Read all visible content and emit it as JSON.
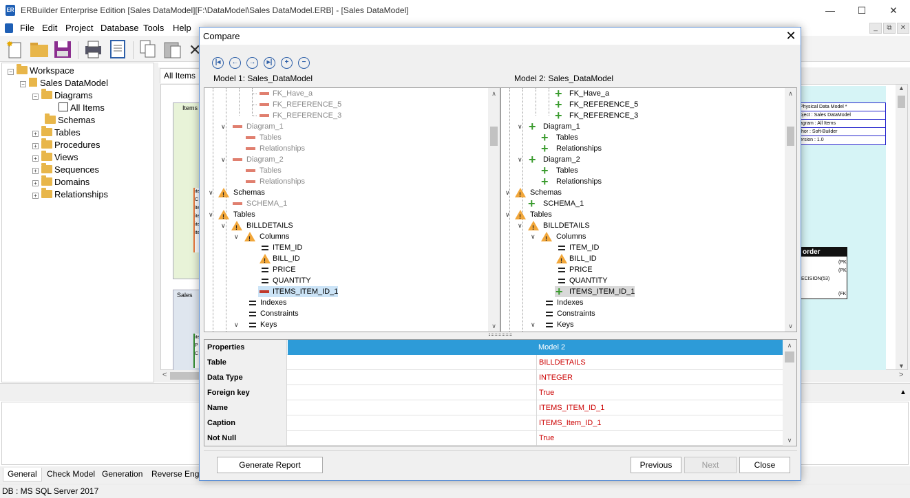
{
  "window": {
    "title": "ERBuilder Enterprise Edition [Sales DataModel][F:\\DataModel\\Sales DataModel.ERB] - [Sales DataModel]",
    "minimize": "—",
    "maximize": "☐",
    "close": "✕"
  },
  "menu": [
    "File",
    "Edit",
    "Project",
    "Database",
    "Tools",
    "Help"
  ],
  "workspace_tree": {
    "workspace": "Workspace",
    "model": "Sales DataModel",
    "diagrams": "Diagrams",
    "all_items": "All Items",
    "schemas": "Schemas",
    "tables": "Tables",
    "procedures": "Procedures",
    "views": "Views",
    "sequences": "Sequences",
    "domains": "Domains",
    "relationships": "Relationships"
  },
  "document_tab": "All Items",
  "canvas": {
    "items_label": "Items",
    "sales_label": "Sales",
    "info_box": [
      "Physical Data Model *",
      "oject : Sales DataModel",
      "agram : All Items",
      "thor : Soft-Builder",
      "ersion : 1.0"
    ],
    "order_table": {
      "header": "order",
      "lines": [
        "(PK",
        "(PK",
        "ECISION(53)",
        "(FK"
      ]
    },
    "left_fragments": [
      "ite",
      "C",
      "ite",
      "ite",
      "ite",
      "ite"
    ],
    "green_fragments": [
      "ite",
      "P",
      "C"
    ]
  },
  "bottom_tabs": [
    "General",
    "Check Model",
    "Generation",
    "Reverse Engin"
  ],
  "status": "DB : MS SQL Server 2017",
  "dialog": {
    "title": "Compare",
    "model1_label": "Model 1: Sales_DataModel",
    "model2_label": "Model 2: Sales_DataModel",
    "left_rows": [
      {
        "text": "FK_Have_a"
      },
      {
        "text": "FK_REFERENCE_5"
      },
      {
        "text": "FK_REFERENCE_3"
      },
      {
        "text": "Diagram_1"
      },
      {
        "text": "Tables"
      },
      {
        "text": "Relationships"
      },
      {
        "text": "Diagram_2"
      },
      {
        "text": "Tables"
      },
      {
        "text": "Relationships"
      },
      {
        "text": "Schemas"
      },
      {
        "text": "SCHEMA_1"
      },
      {
        "text": "Tables"
      },
      {
        "text": "BILLDETAILS"
      },
      {
        "text": "Columns"
      },
      {
        "text": "ITEM_ID"
      },
      {
        "text": "BILL_ID"
      },
      {
        "text": "PRICE"
      },
      {
        "text": "QUANTITY"
      },
      {
        "text": "ITEMS_ITEM_ID_1"
      },
      {
        "text": "Indexes"
      },
      {
        "text": "Constraints"
      },
      {
        "text": "Keys"
      }
    ],
    "right_rows": [
      {
        "text": "FK_Have_a"
      },
      {
        "text": "FK_REFERENCE_5"
      },
      {
        "text": "FK_REFERENCE_3"
      },
      {
        "text": "Diagram_1"
      },
      {
        "text": "Tables"
      },
      {
        "text": "Relationships"
      },
      {
        "text": "Diagram_2"
      },
      {
        "text": "Tables"
      },
      {
        "text": "Relationships"
      },
      {
        "text": "Schemas"
      },
      {
        "text": "SCHEMA_1"
      },
      {
        "text": "Tables"
      },
      {
        "text": "BILLDETAILS"
      },
      {
        "text": "Columns"
      },
      {
        "text": "ITEM_ID"
      },
      {
        "text": "BILL_ID"
      },
      {
        "text": "PRICE"
      },
      {
        "text": "QUANTITY"
      },
      {
        "text": "ITEMS_ITEM_ID_1"
      },
      {
        "text": "Indexes"
      },
      {
        "text": "Constraints"
      },
      {
        "text": "Keys"
      }
    ],
    "properties": {
      "header_name": "Properties",
      "header_model2": "Model 2",
      "rows": [
        {
          "name": "Table",
          "model2": "BILLDETAILS"
        },
        {
          "name": "Data Type",
          "model2": "INTEGER"
        },
        {
          "name": "Foreign key",
          "model2": "True"
        },
        {
          "name": "Name",
          "model2": "ITEMS_ITEM_ID_1"
        },
        {
          "name": "Caption",
          "model2": "ITEMS_Item_ID_1"
        },
        {
          "name": "Not Null",
          "model2": "True"
        }
      ]
    },
    "buttons": {
      "generate_report": "Generate Report",
      "previous": "Previous",
      "next": "Next",
      "close": "Close"
    }
  },
  "colors": {
    "accent": "#2d9bd8",
    "removed": "#e07f6f",
    "added": "#3a9b2e",
    "warning": "#f2a73a",
    "changed_value": "#cc0000"
  }
}
